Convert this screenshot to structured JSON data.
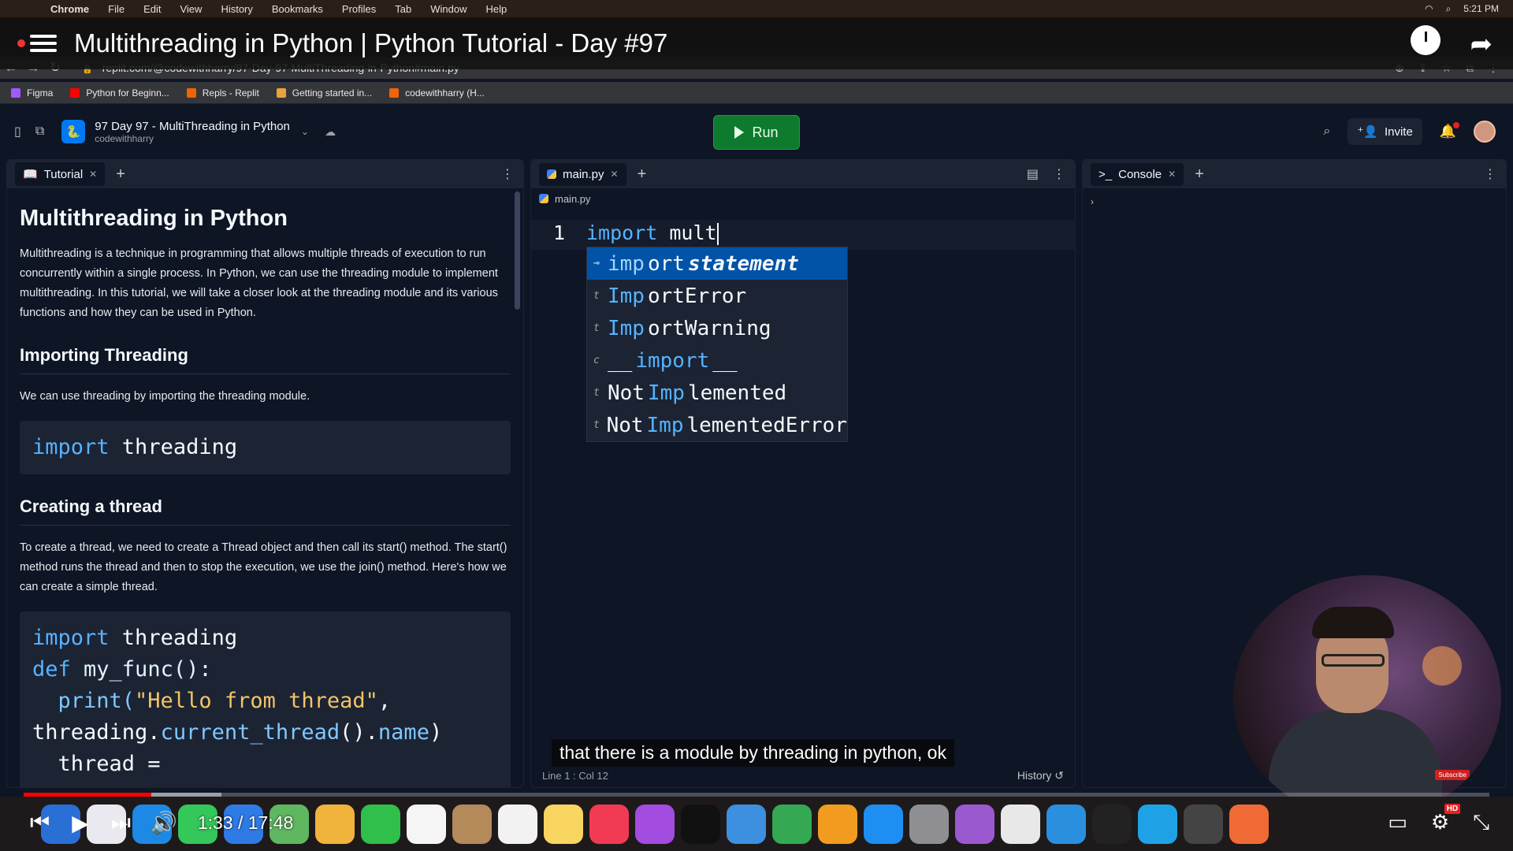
{
  "menubar": {
    "app": "Chrome",
    "items": [
      "File",
      "Edit",
      "View",
      "History",
      "Bookmarks",
      "Profiles",
      "Tab",
      "Window",
      "Help"
    ],
    "clock": "5:21 PM"
  },
  "video": {
    "title": "Multithreading in Python | Python Tutorial - Day #97",
    "subtitle": "that there is a module by threading in python, ok",
    "time_current": "1:33",
    "time_total": "17:48",
    "time_display": "1:33 / 17:48",
    "progress_fraction": 0.087,
    "buffered_fraction": 0.135,
    "hd_badge": "HD",
    "subscribe_label": "Subscribe"
  },
  "browser": {
    "url": "replit.com/@codewithharry/97-Day-97-MultiThreading-in-Python#main.py",
    "bookmarks": [
      "Figma",
      "Python for Beginn...",
      "Repls - Replit",
      "Getting started in...",
      "codewithharry (H..."
    ]
  },
  "replit": {
    "project_name": "97 Day 97 - MultiThreading in Python",
    "owner": "codewithharry",
    "run_label": "Run",
    "invite_label": "Invite"
  },
  "tutorial": {
    "tab_label": "Tutorial",
    "title": "Multithreading in Python",
    "intro": "Multithreading is a technique in programming that allows multiple threads of execution to run concurrently within a single process. In Python, we can use the threading module to implement multithreading. In this tutorial, we will take a closer look at the threading module and its various functions and how they can be used in Python.",
    "h_importing": "Importing Threading",
    "p_importing": "We can use threading by importing the threading module.",
    "code1_kw": "import",
    "code1_rest": " threading",
    "h_creating": "Creating a thread",
    "p_creating": "To create a thread, we need to create a Thread object and then call its start() method. The start() method runs the thread and then to stop the execution, we use the join() method. Here's how we can create a simple thread.",
    "code2": {
      "l1_kw": "import",
      "l1_rest": " threading",
      "l2_kw": "def",
      "l2_rest": " my_func():",
      "l3_fn": "  print(",
      "l3_str": "\"Hello from thread\"",
      "l3_end": ",",
      "l4_a": "threading.",
      "l4_m": "current_thread",
      "l4_b": "().",
      "l4_c": "name",
      "l4_d": ")",
      "l5": "  thread ="
    }
  },
  "editor": {
    "tab_label": "main.py",
    "breadcrumb": "main.py",
    "line_number": "1",
    "code_kw": "import",
    "code_rest": " mult",
    "status": "Line 1 : Col 12",
    "history_label": "History",
    "autocomplete": [
      {
        "kind": "⊸",
        "match": "imp",
        "rest": "ort ",
        "extra": "statement",
        "selected": true
      },
      {
        "kind": "t",
        "match": "Imp",
        "rest": "ortError",
        "extra": "",
        "selected": false
      },
      {
        "kind": "t",
        "match": "Imp",
        "rest": "ortWarning",
        "extra": "",
        "selected": false
      },
      {
        "kind": "c",
        "prefix": "__",
        "match": "import",
        "rest": "__",
        "extra": "",
        "selected": false
      },
      {
        "kind": "t",
        "prefix": "Not",
        "match": "Imp",
        "rest": "lemented",
        "extra": "",
        "selected": false
      },
      {
        "kind": "t",
        "prefix": "Not",
        "match": "Imp",
        "rest": "lementedError",
        "extra": "",
        "selected": false
      }
    ]
  },
  "console": {
    "tab_label": "Console",
    "prompt": "›"
  },
  "colors": {
    "bg": "#0e1525",
    "surface": "#1c2333",
    "accent": "#0079f2",
    "run_green": "#0e7a2e",
    "keyword": "#56b3ff"
  }
}
